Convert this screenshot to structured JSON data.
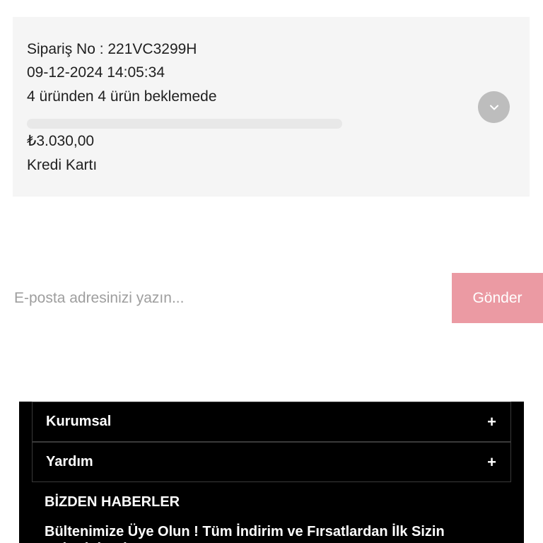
{
  "order": {
    "order_no": "Sipariş No : 221VC3299H",
    "date": "09-12-2024 14:05:34",
    "status": "4 üründen 4 ürün beklemede",
    "progress_percent": 0,
    "price": "₺3.030,00",
    "payment_method": "Kredi Kartı",
    "expand_icon": "chevron-down-icon"
  },
  "newsletter": {
    "placeholder": "E-posta adresinizi yazın...",
    "send_label": "Gönder",
    "send_color": "#eb9aa3"
  },
  "footer": {
    "accordion": [
      {
        "label": "Kurumsal",
        "icon": "+"
      },
      {
        "label": "Yardım",
        "icon": "+"
      }
    ],
    "news_heading": "BİZDEN HABERLER",
    "news_text": "Bültenimize Üye Olun ! Tüm İndirim ve Fırsatlardan İlk Sizin Haberiniz Olsun !"
  }
}
